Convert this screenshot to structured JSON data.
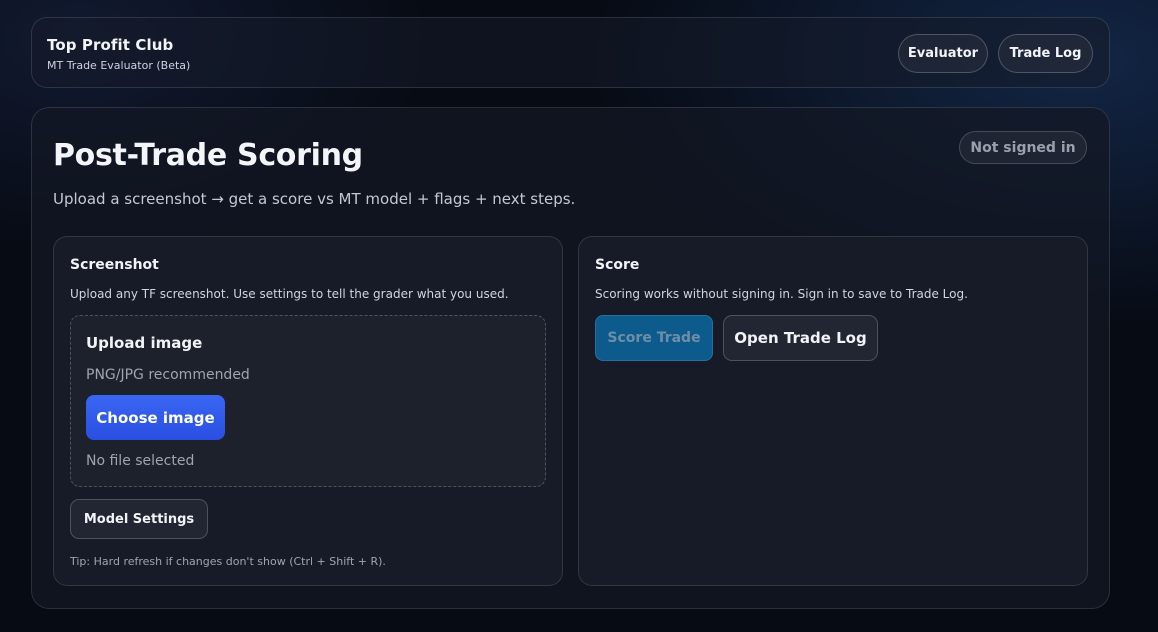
{
  "header": {
    "brand": "Top Profit Club",
    "subtitle": "MT Trade Evaluator (Beta)",
    "nav": {
      "evaluator": "Evaluator",
      "trade_log": "Trade Log"
    }
  },
  "main": {
    "title": "Post-Trade Scoring",
    "subtitle": "Upload a screenshot → get a score vs MT model + flags + next steps.",
    "auth_status": "Not signed in"
  },
  "screenshot_card": {
    "title": "Screenshot",
    "description": "Upload any TF screenshot. Use settings to tell the grader what you used.",
    "upload": {
      "title": "Upload image",
      "hint": "PNG/JPG recommended",
      "button": "Choose image",
      "file_status": "No file selected"
    },
    "model_settings_button": "Model Settings",
    "tip": "Tip: Hard refresh if changes don't show (Ctrl + Shift + R)."
  },
  "score_card": {
    "title": "Score",
    "description": "Scoring works without signing in. Sign in to save to Trade Log.",
    "score_button": "Score Trade",
    "open_log_button": "Open Trade Log"
  }
}
